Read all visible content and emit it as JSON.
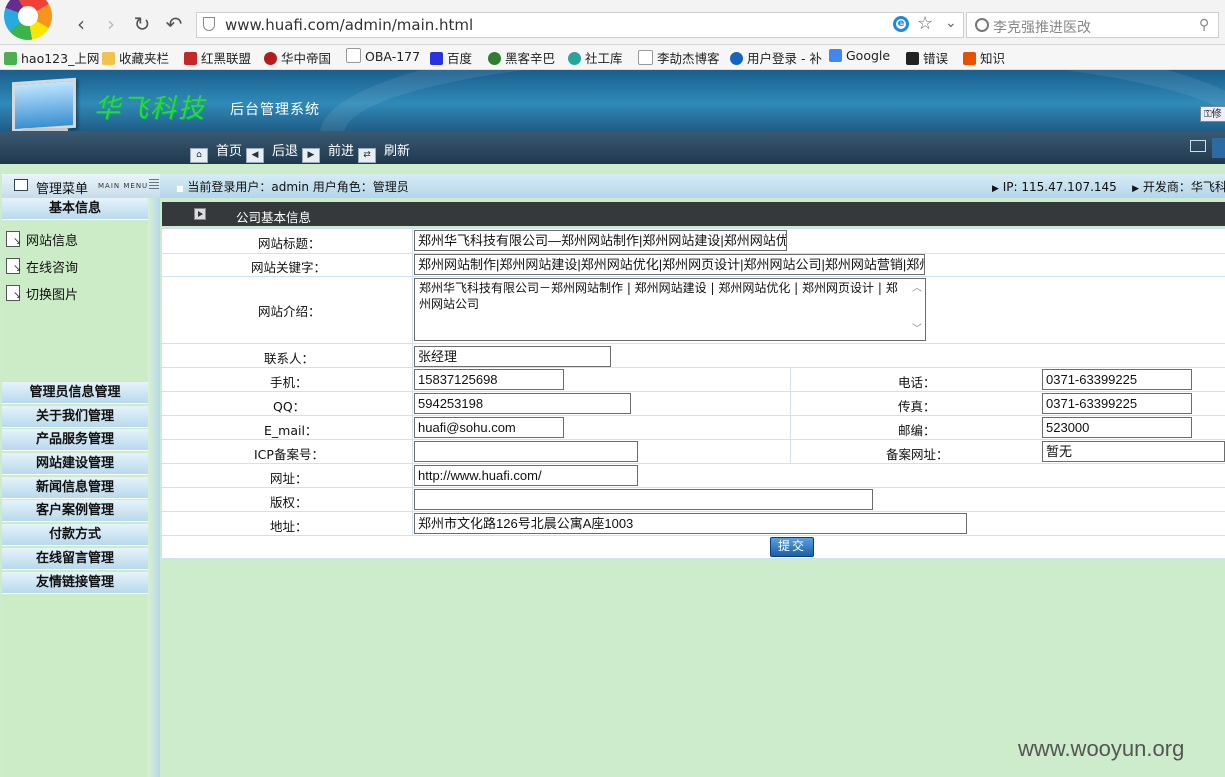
{
  "browser": {
    "url": "www.huafi.com/admin/main.html",
    "search_placeholder": "李克强推进医改",
    "bookmarks": [
      "hao123_上网",
      "收藏夹栏",
      "红黑联盟",
      "华中帝国",
      "OBA-177",
      "百度",
      "黑客辛巴",
      "社工库",
      "李劼杰博客",
      "用户登录 - 补",
      "Google",
      "错误",
      "知识"
    ]
  },
  "site": {
    "brand": "华飞科技",
    "subtitle": "后台管理系统",
    "modify_label": "修",
    "nav": [
      "首页",
      "后退",
      "前进",
      "刷新"
    ]
  },
  "menu": {
    "title": "管理菜单",
    "title_en": "MAIN MENU",
    "sections": [
      "基本信息",
      "管理员信息管理",
      "关于我们管理",
      "产品服务管理",
      "网站建设管理",
      "新闻信息管理",
      "客户案例管理",
      "付款方式",
      "在线留言管理",
      "友情链接管理"
    ],
    "sub_items": [
      "网站信息",
      "在线咨询",
      "切换图片"
    ]
  },
  "status": {
    "user": "当前登录用户：admin 用户角色：管理员",
    "ip": "IP: 115.47.107.145",
    "developer": "开发商：华飞科技"
  },
  "form": {
    "heading": "公司基本信息",
    "labels": {
      "title": "网站标题：",
      "keywords": "网站关键字：",
      "intro": "网站介绍：",
      "contact": "联系人：",
      "mobile": "手机：",
      "phone": "电话：",
      "qq": "QQ：",
      "fax": "传真：",
      "email": "E_mail：",
      "postcode": "邮编：",
      "icp": "ICP备案号：",
      "icp_url": "备案网址：",
      "website": "网址：",
      "copyright": "版权：",
      "address": "地址："
    },
    "values": {
      "title": "郑州华飞科技有限公司—郑州网站制作|郑州网站建设|郑州网站优",
      "keywords": "郑州网站制作|郑州网站建设|郑州网站优化|郑州网页设计|郑州网站公司|郑州网站营销|郑州",
      "intro": "郑州华飞科技有限公司－郑州网站制作 | 郑州网站建设 | 郑州网站优化 | 郑州网页设计 | 郑州网站公司",
      "contact": "张经理",
      "mobile": "15837125698",
      "phone": "0371-63399225",
      "qq": "594253198",
      "fax": "0371-63399225",
      "email": "huafi@sohu.com",
      "postcode": "523000",
      "icp": "",
      "icp_url": "暂无",
      "website": "http://www.huafi.com/",
      "copyright": "",
      "address": "郑州市文化路126号北晨公寓A座1003"
    },
    "submit": "提交"
  },
  "watermark": "www.wooyun.org"
}
